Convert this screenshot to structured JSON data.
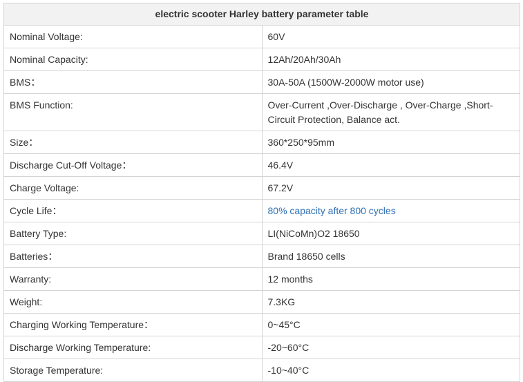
{
  "table": {
    "title": "electric scooter Harley battery parameter table",
    "rows": [
      {
        "label": "Nominal Voltage:",
        "value": "60V"
      },
      {
        "label": "Nominal Capacity:",
        "value": "12Ah/20Ah/30Ah"
      },
      {
        "label": "BMS：",
        "value": "30A-50A (1500W-2000W motor use)"
      },
      {
        "label": "BMS Function:",
        "value": "Over-Current ,Over-Discharge , Over-Charge ,Short-Circuit Protection, Balance act."
      },
      {
        "label": "Size：",
        "value": "360*250*95mm"
      },
      {
        "label": "Discharge Cut-Off Voltage：",
        "value": "46.4V"
      },
      {
        "label": "Charge Voltage:",
        "value": "67.2V"
      },
      {
        "label": "Cycle Life：",
        "value": "80% capacity after 800 cycles"
      },
      {
        "label": "Battery Type:",
        "value": "LI(NiCoMn)O2 18650"
      },
      {
        "label": "Batteries：",
        "value": "Brand 18650 cells"
      },
      {
        "label": "Warranty:",
        "value": "12 months"
      },
      {
        "label": "Weight:",
        "value": "7.3KG"
      },
      {
        "label": "Charging Working Temperature：",
        "value": "0~45°C"
      },
      {
        "label": "Discharge Working Temperature:",
        "value": "-20~60°C"
      },
      {
        "label": "Storage Temperature:",
        "value": "-10~40°C"
      }
    ]
  },
  "colors": {
    "link": "#2e6fb5",
    "header_bg": "#f2f2f2",
    "border": "#d4d4d4"
  }
}
